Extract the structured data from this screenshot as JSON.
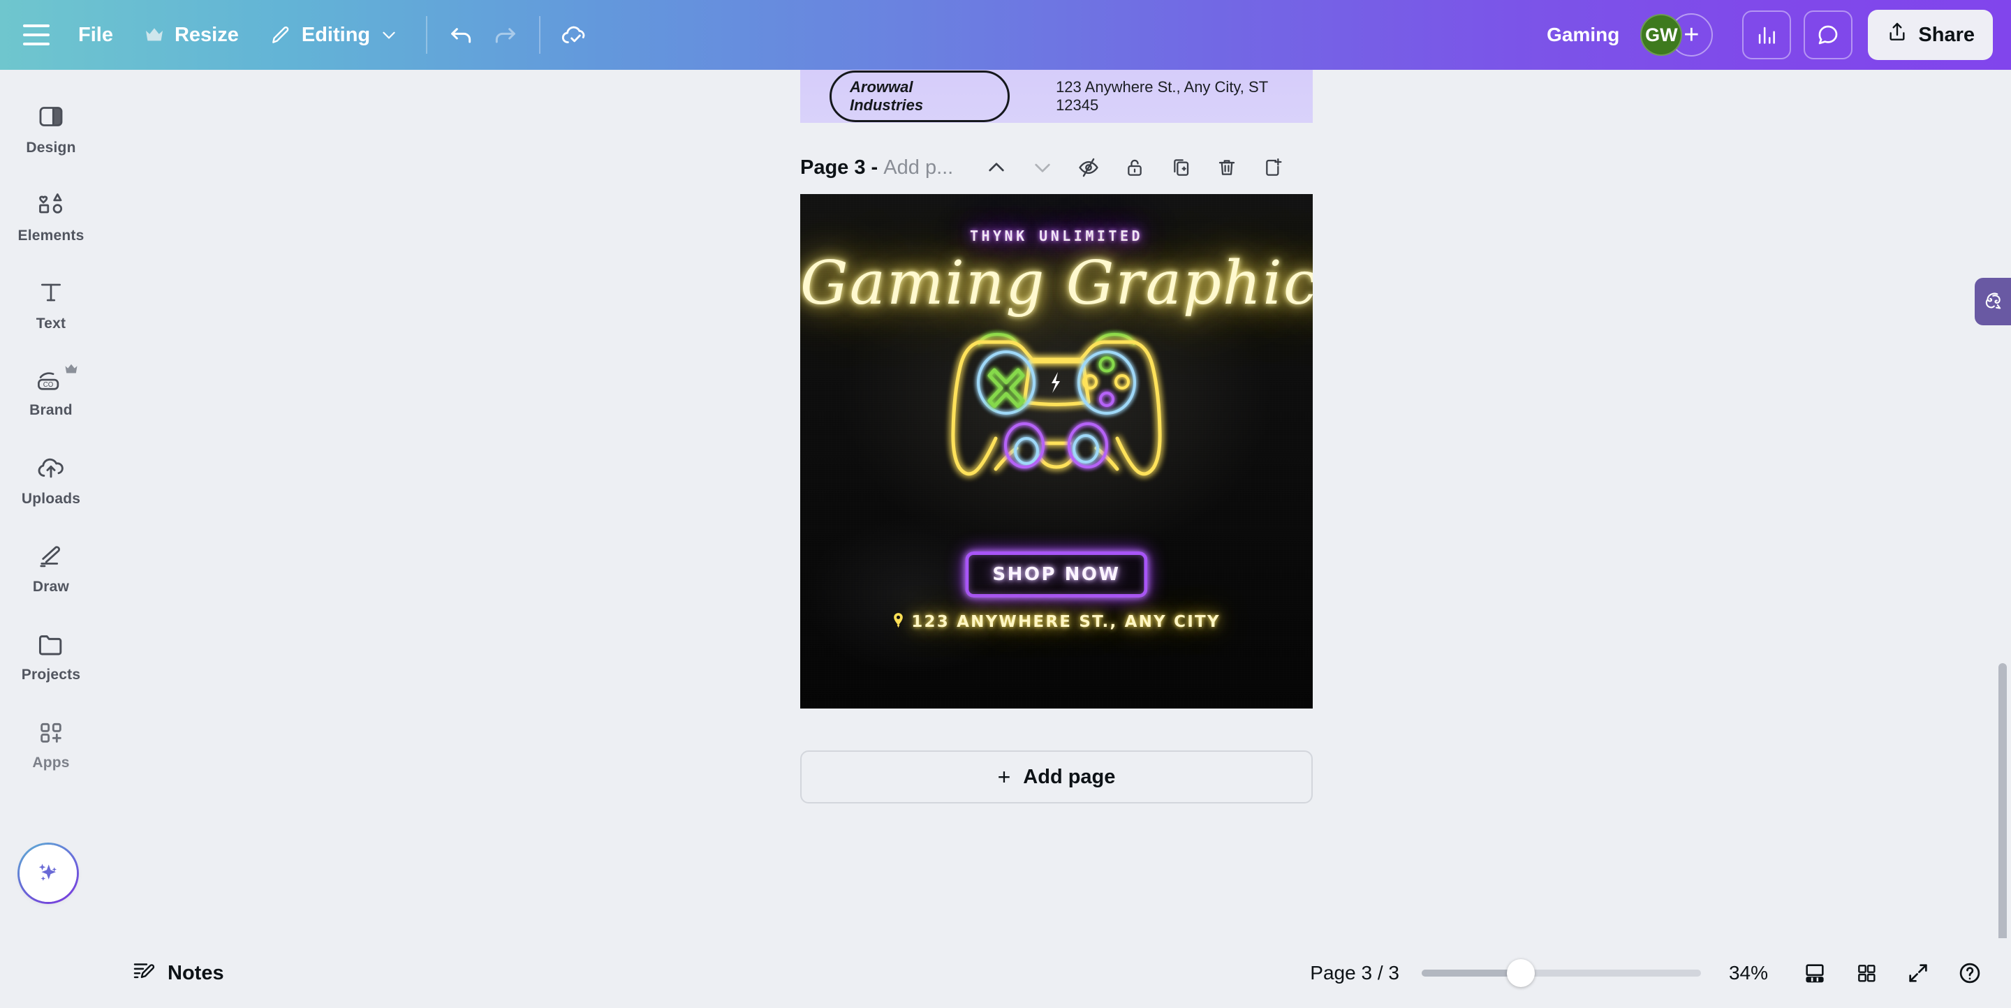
{
  "topbar": {
    "menu_icon": "hamburger-icon",
    "file_label": "File",
    "resize_label": "Resize",
    "resize_icon": "crown-icon",
    "editing_label": "Editing",
    "editing_icon": "pencil-icon",
    "editing_caret": "chevron-down-icon",
    "undo_icon": "undo-icon",
    "redo_icon": "redo-icon",
    "saved_icon": "cloud-check-icon",
    "doc_title": "Gaming",
    "avatar_initials": "GW",
    "avatar_color": "#3E7A1E",
    "add_collaborator_icon": "plus-icon",
    "insights_icon": "bar-chart-icon",
    "comments_icon": "comment-bubble-icon",
    "share_label": "Share",
    "share_icon": "share-upload-icon"
  },
  "sidebar": {
    "items": [
      {
        "label": "Design",
        "icon": "design-panel-icon",
        "pro": false
      },
      {
        "label": "Elements",
        "icon": "shapes-icon",
        "pro": false
      },
      {
        "label": "Text",
        "icon": "text-t-icon",
        "pro": false
      },
      {
        "label": "Brand",
        "icon": "brand-kit-icon",
        "pro": true
      },
      {
        "label": "Uploads",
        "icon": "cloud-upload-icon",
        "pro": false
      },
      {
        "label": "Draw",
        "icon": "draw-pen-icon",
        "pro": false
      },
      {
        "label": "Projects",
        "icon": "folder-icon",
        "pro": false
      },
      {
        "label": "Apps",
        "icon": "apps-grid-plus-icon",
        "pro": false
      }
    ],
    "ai_button_icon": "magic-sparkles-icon"
  },
  "canvas": {
    "previous_page": {
      "brand_pill": "Arowwal Industries",
      "address": "123 Anywhere St., Any City, ST 12345"
    },
    "page_header": {
      "title": "Page 3 - ",
      "placeholder": "Add p...",
      "move_up_icon": "chevron-up-icon",
      "move_down_icon": "chevron-down-icon",
      "hide_icon": "eye-slash-icon",
      "lock_icon": "lock-icon",
      "duplicate_icon": "duplicate-page-icon",
      "delete_icon": "trash-icon",
      "add_after_icon": "add-page-icon"
    },
    "artwork": {
      "kicker": "THYNK UNLIMITED",
      "headline": "Gaming Graphics",
      "cta_label": "SHOP NOW",
      "address": "123 ANYWHERE ST., ANY CITY",
      "address_icon": "location-pin-icon",
      "illustration": "neon-game-controller",
      "neon_yellow": "#FFE25A",
      "neon_purple": "#A855F7",
      "neon_blue": "#7DD3FC",
      "neon_green": "#86D94C",
      "background": "#0A0A0A"
    },
    "add_page_label": "Add page",
    "add_page_plus": "+"
  },
  "assistant": {
    "icon": "canva-assistant-brain-icon",
    "color": "#6959A3"
  },
  "bottombar": {
    "notes_label": "Notes",
    "notes_icon": "notes-pencil-icon",
    "page_count": "Page 3 / 3",
    "zoom_level": "34%",
    "zoom_value": 34,
    "layout_icon": "page-layout-icon",
    "grid_view_icon": "grid-view-icon",
    "fullscreen_icon": "expand-arrows-icon",
    "help_icon": "help-question-icon"
  }
}
